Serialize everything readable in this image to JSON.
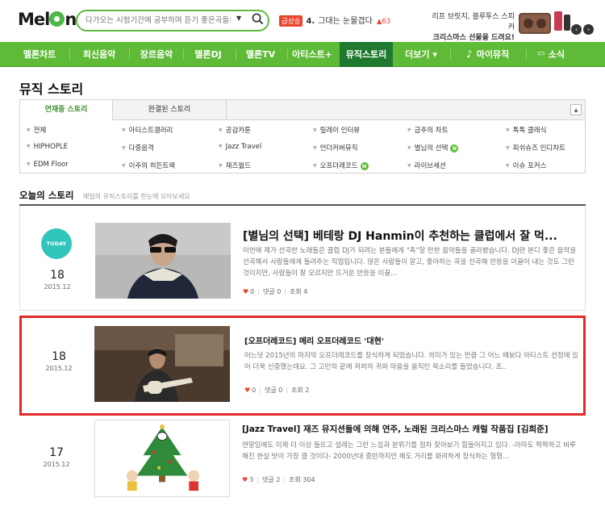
{
  "header": {
    "logo": "MelOn",
    "search": {
      "placeholder": "다가오는 시험기간에 공부하며 듣기 좋은곡들!!"
    },
    "hot": {
      "badge": "급상승",
      "rank": "4.",
      "title": "그대는 눈물겹다",
      "change": "▲63"
    },
    "promo": {
      "line1": "리프 브릿지, 블루투스 스피커",
      "line2": "크리스마스 선물을 드려요!"
    }
  },
  "nav": {
    "items": [
      {
        "label": "멜론차트"
      },
      {
        "label": "최신음악"
      },
      {
        "label": "장르음악"
      },
      {
        "label": "멜론DJ"
      },
      {
        "label": "멜론TV"
      },
      {
        "label": "아티스트+"
      },
      {
        "label": "뮤직스토리"
      },
      {
        "label": "더보기 ▾"
      },
      {
        "label": "마이뮤직"
      },
      {
        "label": "소식"
      }
    ]
  },
  "page": {
    "title": "뮤직 스토리",
    "tabs": [
      "연재중 스토리",
      "완결된 스토리"
    ],
    "categories": [
      [
        "전체",
        "아티스트갤러리",
        "공감카툰",
        "릴레이 인터뷰",
        "금주의 차트",
        "톡톡 클래식"
      ],
      [
        "HIPHOPLE",
        "다중음격",
        "Jazz Travel",
        "언더커버뮤직",
        "별님의 선택",
        "피쉬슈즈 인디차트"
      ],
      [
        "EDM Floor",
        "이주의 히든트랙",
        "재즈월드",
        "오프더레코드",
        "라이브세션",
        "이슈 포커스"
      ]
    ],
    "new_badge": "N",
    "today": {
      "title": "오늘의 스토리",
      "subtitle": "매일의 뮤직스토리를 한눈에 모아보세요"
    }
  },
  "stories": [
    {
      "badge": "TODAY",
      "day": "18",
      "ym": "2015.12",
      "title": "[별님의 선택] 베테랑 DJ Hanmin이 추천하는 클럽에서 잘 먹...",
      "desc": "이번에 제가 선곡한 노래들은 클럽 DJ가 되려는 분들에게 \"촉\"할 만한 음악들을 골라봤습니다. DJ란 본디 좋은 음악을 선곡해서 사람들에게 들려주는 직업입니다. 많은 사람들이 알고, 좋아하는 곡을 선곡해 반응을 이끌어 내는 것도 그런 것이지만, 사람들이 잘 모르지만 뜨거운 반응을 이끌...",
      "likes": "0",
      "comments": "댓글 0",
      "views": "조회 4"
    },
    {
      "day": "18",
      "ym": "2015.12",
      "title": "[오프더레코드] 메리 오프더레코드 '대현'",
      "desc": "어느덧 2015년의 마지막 오프더레코드를 장식하게 되었습니다. 의미가 있는 만큼 그 어느 때보다 아티스트 선정에 있어 더욱 신중했는데요. 그 고민의 끝에 저희의 귀와 마음을 움직인 목소리를 들었습니다. 조..",
      "likes": "0",
      "comments": "댓글 0",
      "views": "조회 2"
    },
    {
      "day": "17",
      "ym": "2015.12",
      "title": "[Jazz Travel] 재즈 뮤지션들에 의해 연주, 노래된 크리스마스 캐럴 작품집 [김희준]",
      "desc": "연말임에도 이제 더 이상 들뜨고 설레는 그런 느낌과 분위기를 점차 찾아보기 힘들어지고 있다. -아마도 팍팍하고 비루해진 현실 탓이 가장 클 것이다- 2000년대 중반까지만 해도 거리를 화려하게 장식하는 형형...",
      "likes": "3",
      "comments": "댓글 2",
      "views": "조회 304"
    }
  ],
  "colors": {
    "brand_green": "#5fbb37",
    "active_nav": "#1f7a30",
    "highlight_red": "#e12a2a",
    "today_teal": "#2fc4bc"
  }
}
